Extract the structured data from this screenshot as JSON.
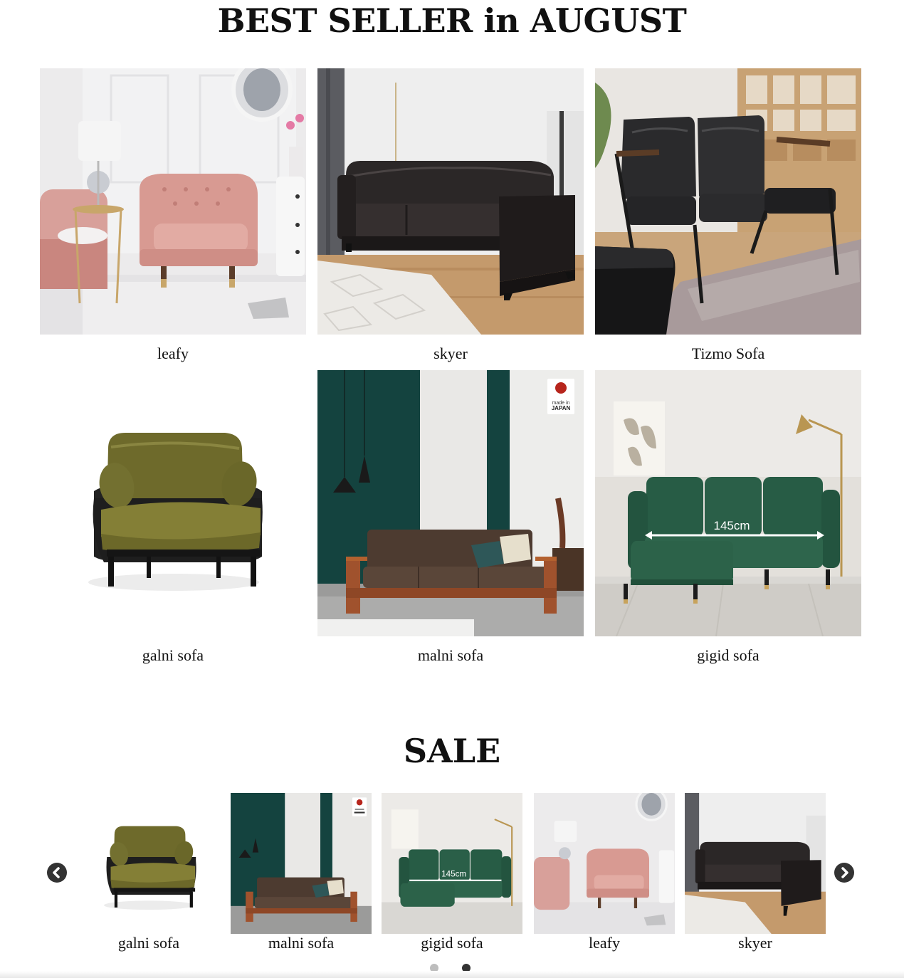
{
  "best_seller": {
    "title": "BEST SELLER in AUGUST",
    "products": [
      {
        "name": "leafy"
      },
      {
        "name": "skyer"
      },
      {
        "name": "Tizmo Sofa"
      },
      {
        "name": "galni sofa"
      },
      {
        "name": "malni sofa",
        "badge": {
          "line1": "made in",
          "line2": "JAPAN"
        }
      },
      {
        "name": "gigid sofa",
        "dimension_label": "145cm"
      }
    ]
  },
  "sale": {
    "title": "SALE",
    "products": [
      {
        "name": "galni sofa"
      },
      {
        "name": "malni sofa"
      },
      {
        "name": "gigid sofa",
        "dimension_label": "145cm"
      },
      {
        "name": "leafy"
      },
      {
        "name": "skyer"
      }
    ],
    "prev_icon": "chevron-left-icon",
    "next_icon": "chevron-right-icon",
    "pagination": {
      "pages": 2,
      "active_page": 2
    }
  },
  "colors": {
    "text": "#111111",
    "dot_inactive": "#bdbdbd",
    "dot_active": "#333333",
    "arrow_bg": "#333333"
  }
}
